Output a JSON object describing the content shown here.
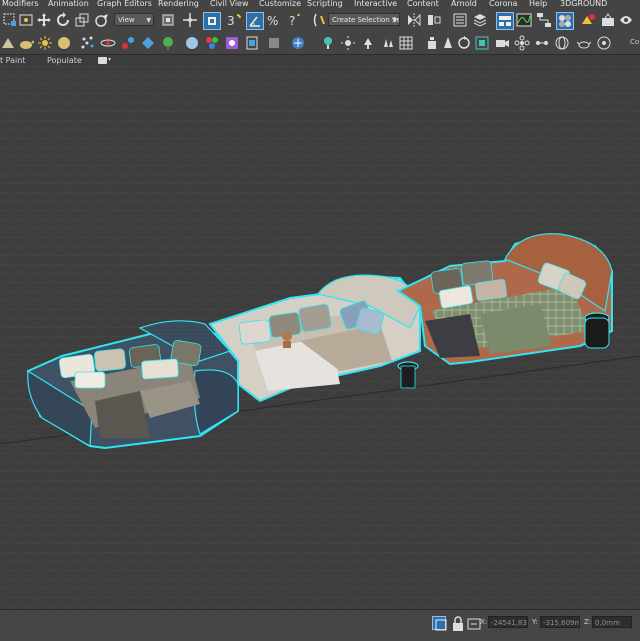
{
  "menubar": {
    "items": [
      "Modifiers",
      "Animation",
      "Graph Editors",
      "Rendering",
      "Civil View",
      "Customize",
      "Scripting",
      "Interactive",
      "Content",
      "Arnold",
      "Corona",
      "Help",
      "3DGROUND"
    ]
  },
  "toolbar1": {
    "view_dropdown": "View",
    "selection_set_dropdown": "Create Selection Se",
    "right_edge_text": "Co"
  },
  "ribbon": {
    "items": [
      "t Paint",
      "Populate"
    ]
  },
  "statusbar": {
    "x_label": "X:",
    "x_value": "-24541,83",
    "y_label": "Y:",
    "y_value": "-315,609m",
    "z_label": "Z:",
    "z_value": "0,0mm"
  },
  "colors": {
    "selection_outline": "#2ee6f2",
    "viewport_bg": "#3d3d3d",
    "grid": "#4a4a4a"
  }
}
